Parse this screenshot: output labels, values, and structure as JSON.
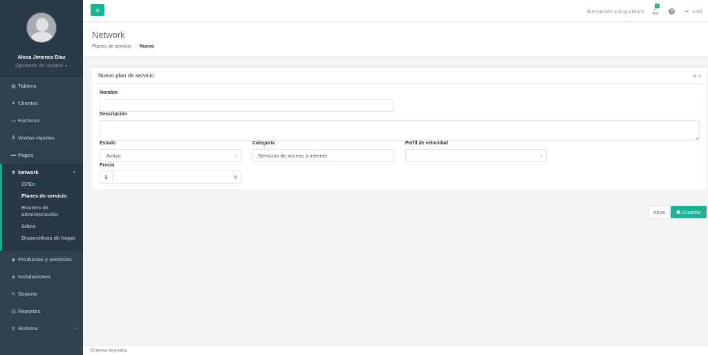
{
  "user": {
    "name": "Alexa Jimenez Díaz",
    "options_label": "Opciones de usuario"
  },
  "sidebar": {
    "items": [
      {
        "label": "Tablero",
        "icon": "dashboard-icon"
      },
      {
        "label": "Clientes",
        "icon": "users-icon"
      },
      {
        "label": "Facturas",
        "icon": "file-icon"
      },
      {
        "label": "Ventas rápidas",
        "icon": "dollar-icon"
      },
      {
        "label": "Pagos",
        "icon": "money-icon"
      }
    ],
    "active": {
      "label": "Network",
      "icon": "network-icon",
      "subitems": [
        {
          "label": "CPEs"
        },
        {
          "label": "Planes de servicio"
        },
        {
          "label": "Routers de administración"
        },
        {
          "label": "Sitios"
        },
        {
          "label": "Dispositivos de hogar"
        }
      ]
    },
    "items_after": [
      {
        "label": "Productos y servicios",
        "icon": "tag-icon"
      },
      {
        "label": "Instalaciones",
        "icon": "tools-icon"
      },
      {
        "label": "Soporte",
        "icon": "wrench-icon"
      },
      {
        "label": "Reportes",
        "icon": "report-icon"
      },
      {
        "label": "Sistema",
        "icon": "gears-icon"
      }
    ]
  },
  "topbar": {
    "welcome": "Bienvenido a ArgusBlack",
    "notifications_count": "1",
    "help_glyph": "?",
    "logout": "Salir"
  },
  "page": {
    "title": "Network",
    "breadcrumb": {
      "parent": "Planes de servicio",
      "separator": "/",
      "current": "Nuevo"
    }
  },
  "form": {
    "title": "Nuevo plan de servicio",
    "nombre": {
      "label": "Nombre",
      "value": ""
    },
    "descripcion": {
      "label": "Descripción",
      "value": ""
    },
    "estado": {
      "label": "Estado",
      "value": "Activo"
    },
    "categoria": {
      "label": "Categoría",
      "value": "Servicios de acceso a internet"
    },
    "perfil": {
      "label": "Perfil de velocidad",
      "value": ""
    },
    "precio": {
      "label": "Precio",
      "currency": "$",
      "value": "0"
    }
  },
  "actions": {
    "back": "Atras",
    "save": "Guardar"
  },
  "footer": {
    "company": "Empresa de prueba"
  },
  "colors": {
    "accent": "#1ab394",
    "sidebar_bg": "#2f4050"
  }
}
